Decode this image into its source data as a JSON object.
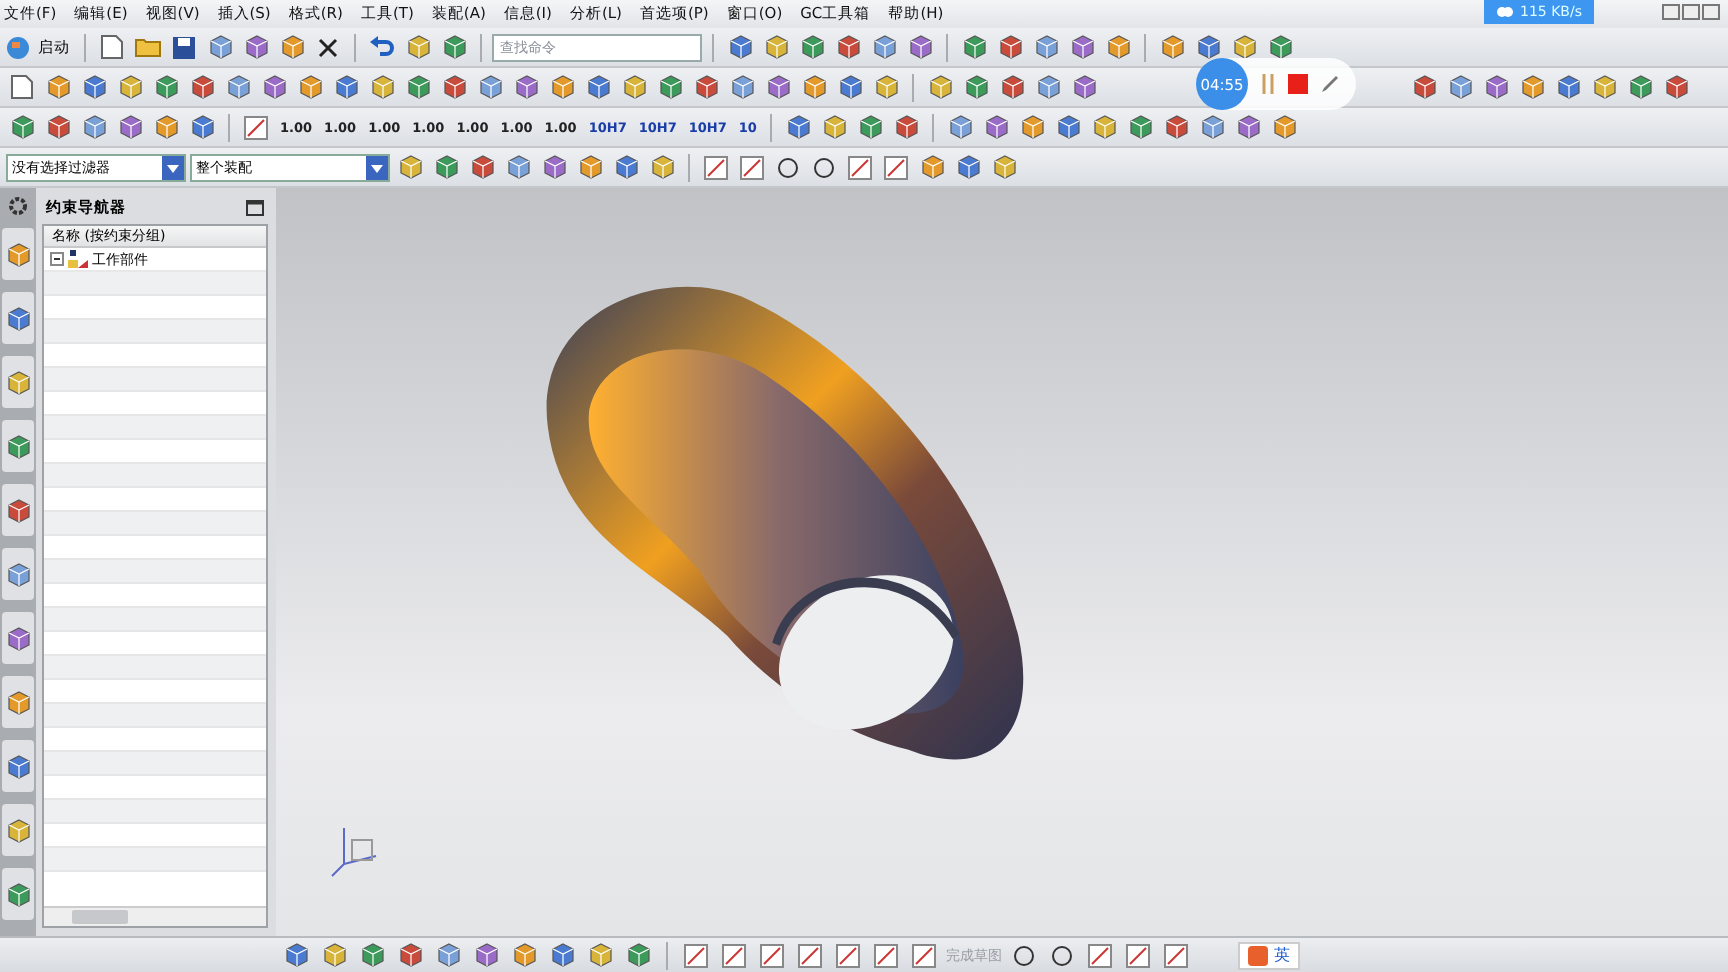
{
  "menu": [
    "文件(F)",
    "编辑(E)",
    "视图(V)",
    "插入(S)",
    "格式(R)",
    "工具(T)",
    "装配(A)",
    "信息(I)",
    "分析(L)",
    "首选项(P)",
    "窗口(O)",
    "GC工具箱",
    "帮助(H)"
  ],
  "start_button": {
    "label": "启动"
  },
  "command_search": {
    "placeholder": "查找命令"
  },
  "dimension_buttons": [
    "1.00",
    "1.00",
    "1.00",
    "1.00",
    "1.00",
    "1.00",
    "1.00",
    "10H7",
    "10H7",
    "10H7",
    "10"
  ],
  "filters": [
    {
      "value": "没有选择过滤器"
    },
    {
      "value": "整个装配"
    }
  ],
  "navigator": {
    "title": "约束导航器",
    "column": "名称 (按约束分组)",
    "tree": [
      {
        "label": "工作部件",
        "expanded": true
      }
    ]
  },
  "recorder": {
    "time": "04:55"
  },
  "network": {
    "speed": "115 KB/s"
  },
  "sketch_finish": {
    "label": "完成草图",
    "disabled": true
  },
  "ime": {
    "label": "英"
  }
}
